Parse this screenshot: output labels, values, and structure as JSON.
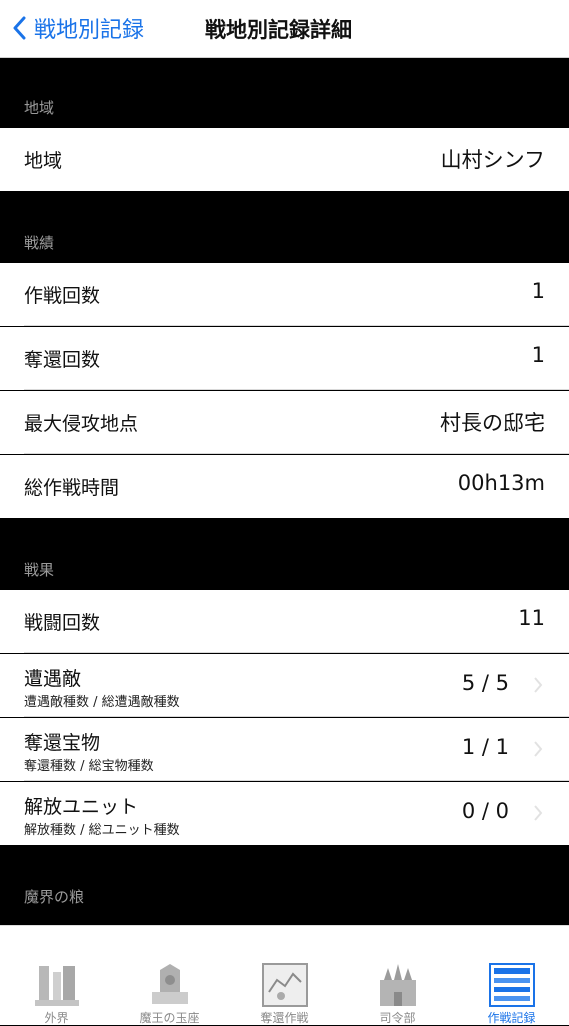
{
  "nav": {
    "back_label": "戦地別記録",
    "title": "戦地別記録詳細"
  },
  "sections": {
    "region": {
      "header": "地域",
      "rows": [
        {
          "label": "地域",
          "value": "山村シンフ"
        }
      ]
    },
    "record": {
      "header": "戦績",
      "rows": [
        {
          "label": "作戦回数",
          "value": "1"
        },
        {
          "label": "奪還回数",
          "value": "1"
        },
        {
          "label": "最大侵攻地点",
          "value": "村長の邸宅"
        },
        {
          "label": "総作戦時間",
          "value": "00h13m"
        }
      ]
    },
    "results": {
      "header": "戦果",
      "rows": [
        {
          "label": "戦闘回数",
          "value": "11"
        },
        {
          "label": "遭遇敵",
          "sublabel": "遭遇敵種数 / 総遭遇敵種数",
          "value": "5 / 5"
        },
        {
          "label": "奪還宝物",
          "sublabel": "奪還種数 / 総宝物種数",
          "value": "1 / 1"
        },
        {
          "label": "解放ユニット",
          "sublabel": "解放種数 / 総ユニット種数",
          "value": "0 / 0"
        }
      ]
    },
    "demon": {
      "header": "魔界の粮"
    }
  },
  "tabs": [
    {
      "label": "外界",
      "icon": "outer-world-icon"
    },
    {
      "label": "魔王の玉座",
      "icon": "throne-icon"
    },
    {
      "label": "奪還作戦",
      "icon": "map-icon"
    },
    {
      "label": "司令部",
      "icon": "headquarters-icon"
    },
    {
      "label": "作戦記録",
      "icon": "records-icon",
      "active": true
    }
  ],
  "colors": {
    "accent": "#1a73e8",
    "header_bg": "#000000",
    "header_text": "#9a9a9a",
    "cell_bg": "#ffffff"
  }
}
